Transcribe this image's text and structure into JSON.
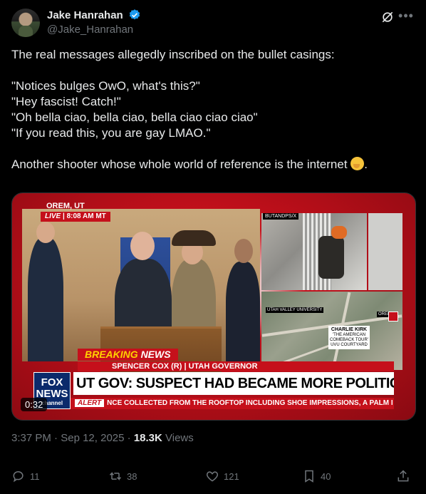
{
  "author": {
    "display_name": "Jake Hanrahan",
    "handle": "@Jake_Hanrahan"
  },
  "tweet": {
    "lines": [
      "The real messages allegedly inscribed on the bullet casings:",
      "\"Notices bulges OwO, what's this?\"",
      "\"Hey fascist! Catch!\"",
      "\"Oh bella ciao, bella ciao, bella ciao ciao ciao\"",
      "\"If you read this, you are gay LMAO.\"",
      "Another shooter whose whole world of reference is the internet",
      "."
    ]
  },
  "video": {
    "location": "OREM, UT",
    "live_label": "LIVE",
    "live_time": "8:08 AM MT",
    "cam_label": "BUTANDPS/X",
    "map_label": "UTAH VALLEY UNIVERSITY",
    "map_pin_label": "OREM",
    "kirk_title": "CHARLIE KIRK",
    "kirk_sub": "'THE AMERICAN COMEBACK TOUR'",
    "kirk_sub2": "UVU COURTYARD",
    "breaking_1": "BREAKING",
    "breaking_2": "NEWS",
    "speaker": "SPENCER COX (R) | UTAH GOVERNOR",
    "headline": "UT GOV: SUSPECT HAD BECAME MORE POLITICAL RECENTLY",
    "alert_label": "ALERT",
    "ticker": "NCE COLLECTED FROM THE ROOFTOP INCLUDING SHOE IMPRESSIONS, A PALM I",
    "logo_top": "FOX",
    "logo_mid": "NEWS",
    "logo_bottom": "channel",
    "duration": "0:32"
  },
  "meta": {
    "time": "3:37 PM",
    "date": "Sep 12, 2025",
    "views_count": "18.3K",
    "views_label": "Views"
  },
  "actions": {
    "replies": "11",
    "reposts": "38",
    "likes": "121",
    "bookmarks": "40"
  },
  "colors": {
    "background": "#000000",
    "text": "#e7e9ea",
    "muted": "#71767b",
    "verified": "#1d9bf0",
    "fox_red": "#c5101b"
  }
}
